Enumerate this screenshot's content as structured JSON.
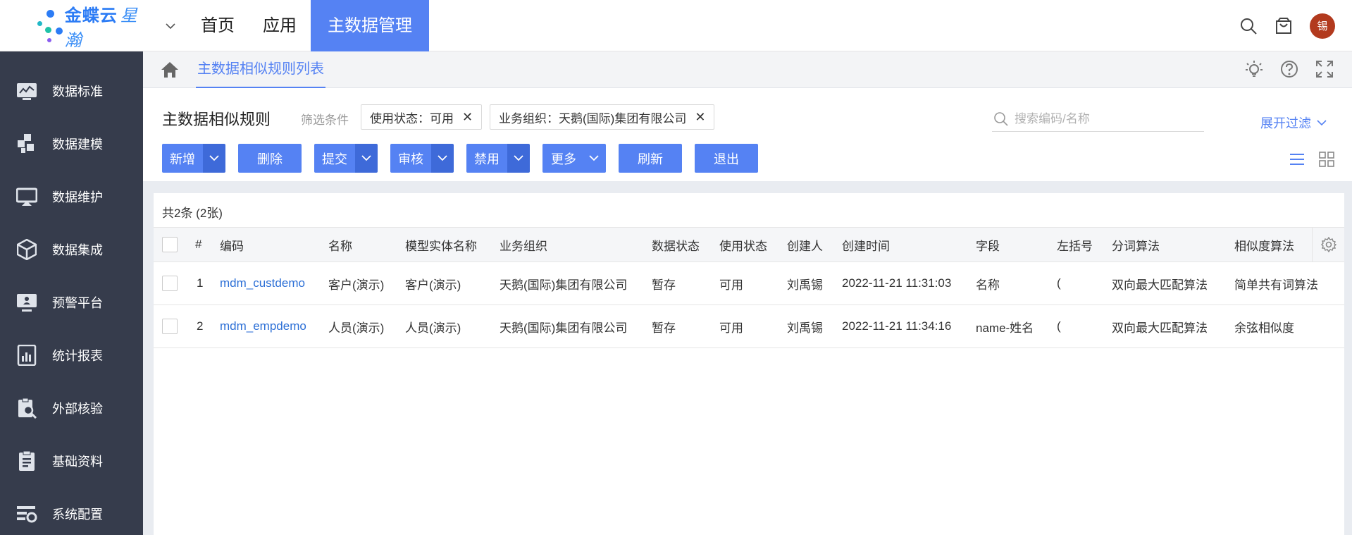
{
  "brand": {
    "name": "金蝶云",
    "product": "星瀚"
  },
  "nav": {
    "items": [
      "首页",
      "应用",
      "主数据管理"
    ],
    "active_index": 2
  },
  "user": {
    "avatar_text": "锡"
  },
  "colors": {
    "primary": "#5582f3",
    "sidebar": "#363c4c",
    "link": "#2c6fd6",
    "avatar": "#b23a1e"
  },
  "sidebar": {
    "items": [
      {
        "label": "数据标准",
        "icon": "chart-monitor-icon"
      },
      {
        "label": "数据建模",
        "icon": "modeling-icon"
      },
      {
        "label": "数据维护",
        "icon": "screen-icon"
      },
      {
        "label": "数据集成",
        "icon": "cube-icon"
      },
      {
        "label": "预警平台",
        "icon": "alert-monitor-icon"
      },
      {
        "label": "统计报表",
        "icon": "report-icon"
      },
      {
        "label": "外部核验",
        "icon": "verify-icon"
      },
      {
        "label": "基础资料",
        "icon": "clipboard-icon"
      },
      {
        "label": "系统配置",
        "icon": "config-icon"
      }
    ]
  },
  "breadcrumb": {
    "tab": "主数据相似规则列表"
  },
  "page": {
    "title": "主数据相似规则",
    "filter_label": "筛选条件",
    "chips": [
      "使用状态：可用",
      "业务组织：天鹅(国际)集团有限公司"
    ],
    "search_placeholder": "搜索编码/名称",
    "expand_filter": "展开过滤"
  },
  "toolbar": {
    "new": "新增",
    "delete": "删除",
    "submit": "提交",
    "audit": "审核",
    "disable": "禁用",
    "more": "更多",
    "refresh": "刷新",
    "exit": "退出"
  },
  "table": {
    "count": "共2条 (2张)",
    "columns": [
      "#",
      "编码",
      "名称",
      "模型实体名称",
      "业务组织",
      "数据状态",
      "使用状态",
      "创建人",
      "创建时间",
      "字段",
      "左括号",
      "分词算法",
      "相似度算法"
    ],
    "rows": [
      [
        "1",
        "mdm_custdemo",
        "客户(演示)",
        "客户(演示)",
        "天鹅(国际)集团有限公司",
        "暂存",
        "可用",
        "刘禹锡",
        "2022-11-21 11:31:03",
        "名称",
        "(",
        "双向最大匹配算法",
        "简单共有词算法"
      ],
      [
        "2",
        "mdm_empdemo",
        "人员(演示)",
        "人员(演示)",
        "天鹅(国际)集团有限公司",
        "暂存",
        "可用",
        "刘禹锡",
        "2022-11-21 11:34:16",
        "name-姓名",
        "(",
        "双向最大匹配算法",
        "余弦相似度"
      ]
    ]
  }
}
